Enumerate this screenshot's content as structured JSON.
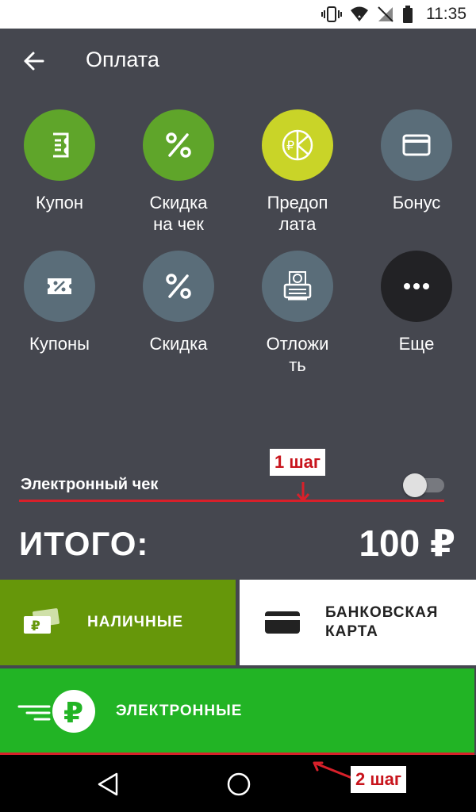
{
  "status": {
    "time": "11:35"
  },
  "header": {
    "title": "Оплата"
  },
  "tiles": [
    {
      "label": "Купон",
      "icon": "coupon-icon"
    },
    {
      "label": "Скидка\nна чек",
      "icon": "percent-icon"
    },
    {
      "label": "Предоп\nлата",
      "icon": "prepayment-icon"
    },
    {
      "label": "Бонус",
      "icon": "card-icon"
    },
    {
      "label": "Купоны",
      "icon": "coupons-icon"
    },
    {
      "label": "Скидка",
      "icon": "percent-icon"
    },
    {
      "label": "Отложи\nть",
      "icon": "receipt-printer-icon"
    },
    {
      "label": "Еще",
      "icon": "more-icon"
    }
  ],
  "echeck": {
    "label": "Электронный чек",
    "enabled": false
  },
  "annotations": {
    "step1": "1 шаг",
    "step2": "2 шаг"
  },
  "total": {
    "label": "ИТОГО:",
    "value": "100 ₽"
  },
  "payments": {
    "cash": "НАЛИЧНЫЕ",
    "card": "БАНКОВСКАЯ\nКАРТА",
    "electronic": "ЭЛЕКТРОННЫЕ"
  },
  "colors": {
    "background": "#45474f",
    "cash": "#66970a",
    "electronic": "#22b425",
    "annotation": "#d8202a"
  }
}
